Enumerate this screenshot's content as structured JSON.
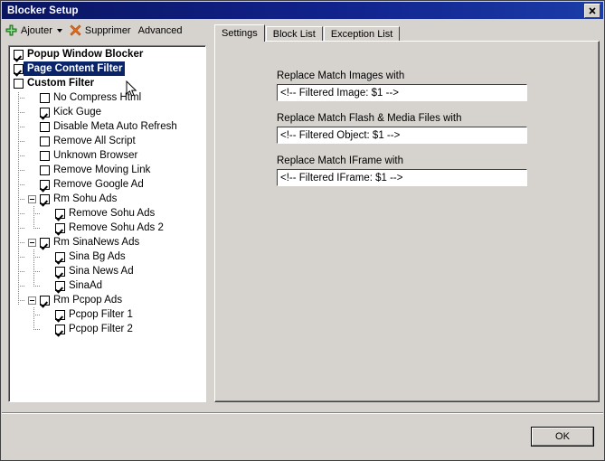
{
  "window": {
    "title": "Blocker Setup",
    "close_label": "✕"
  },
  "toolbar": {
    "add_label": "Ajouter",
    "add_icon": "plus-icon",
    "delete_label": "Supprimer",
    "delete_icon": "x-icon",
    "advanced_label": "Advanced"
  },
  "tree": {
    "items": [
      {
        "label": "Popup Window Blocker",
        "level": 0,
        "checked": true,
        "expander": false,
        "selected": false
      },
      {
        "label": "Page Content Filter",
        "level": 0,
        "checked": true,
        "expander": false,
        "selected": true
      },
      {
        "label": "Custom Filter",
        "level": 0,
        "checked": false,
        "expander": false,
        "selected": false
      },
      {
        "label": "No Compress Html",
        "level": 1,
        "checked": false,
        "expander": false,
        "selected": false
      },
      {
        "label": "Kick Guge",
        "level": 1,
        "checked": true,
        "expander": false,
        "selected": false
      },
      {
        "label": "Disable Meta Auto Refresh",
        "level": 1,
        "checked": false,
        "expander": false,
        "selected": false
      },
      {
        "label": "Remove All Script",
        "level": 1,
        "checked": false,
        "expander": false,
        "selected": false
      },
      {
        "label": "Unknown Browser",
        "level": 1,
        "checked": false,
        "expander": false,
        "selected": false
      },
      {
        "label": "Remove Moving Link",
        "level": 1,
        "checked": false,
        "expander": false,
        "selected": false
      },
      {
        "label": "Remove Google Ad",
        "level": 1,
        "checked": true,
        "expander": false,
        "selected": false
      },
      {
        "label": "Rm Sohu Ads",
        "level": 1,
        "checked": true,
        "expander": true,
        "selected": false
      },
      {
        "label": "Remove Sohu Ads",
        "level": 2,
        "checked": true,
        "expander": false,
        "selected": false
      },
      {
        "label": "Remove Sohu Ads 2",
        "level": 2,
        "checked": true,
        "expander": false,
        "selected": false
      },
      {
        "label": "Rm SinaNews Ads",
        "level": 1,
        "checked": true,
        "expander": true,
        "selected": false
      },
      {
        "label": "Sina Bg Ads",
        "level": 2,
        "checked": true,
        "expander": false,
        "selected": false
      },
      {
        "label": "Sina News Ad",
        "level": 2,
        "checked": true,
        "expander": false,
        "selected": false
      },
      {
        "label": "SinaAd",
        "level": 2,
        "checked": true,
        "expander": false,
        "selected": false
      },
      {
        "label": "Rm Pcpop Ads",
        "level": 1,
        "checked": true,
        "expander": true,
        "selected": false
      },
      {
        "label": "Pcpop Filter 1",
        "level": 2,
        "checked": true,
        "expander": false,
        "selected": false
      },
      {
        "label": "Pcpop Filter 2",
        "level": 2,
        "checked": true,
        "expander": false,
        "selected": false
      }
    ]
  },
  "tabs": [
    {
      "label": "Settings",
      "active": true
    },
    {
      "label": "Block List",
      "active": false
    },
    {
      "label": "Exception List",
      "active": false
    }
  ],
  "settings": {
    "fields": [
      {
        "label": "Replace Match Images with",
        "value": "<!-- Filtered Image: $1 -->"
      },
      {
        "label": "Replace Match Flash & Media Files with",
        "value": "<!-- Filtered Object: $1 -->"
      },
      {
        "label": "Replace Match IFrame with",
        "value": "<!-- Filtered IFrame: $1 -->"
      }
    ]
  },
  "footer": {
    "ok_label": "OK"
  },
  "colors": {
    "titlebar": "#11228c",
    "selection": "#0a246a",
    "face": "#d6d3ce",
    "add_icon": "#3caa3c",
    "delete_icon": "#e06a20"
  }
}
